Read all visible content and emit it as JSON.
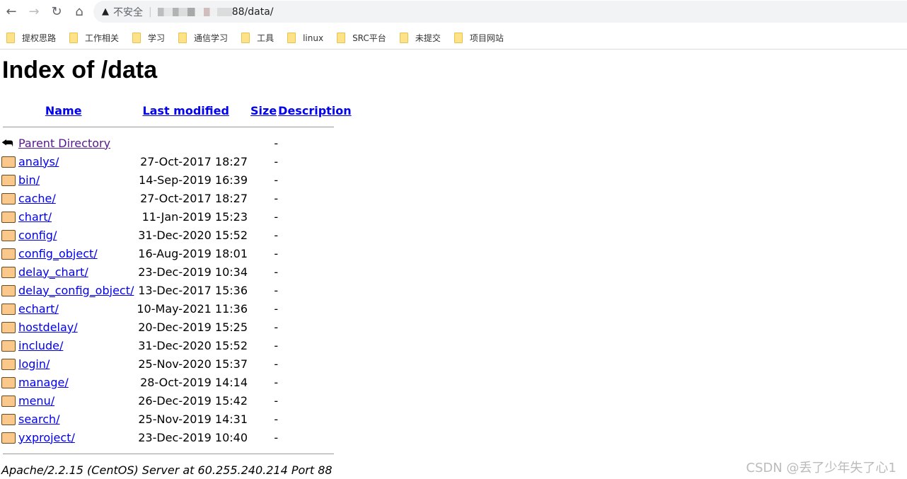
{
  "browser": {
    "url_security": "不安全",
    "url_visible": "88/data/"
  },
  "bookmarks": [
    "提权思路",
    "工作相关",
    "学习",
    "通信学习",
    "工具",
    "linux",
    "SRC平台",
    "未提交",
    "项目网站"
  ],
  "page": {
    "title": "Index of /data",
    "headers": {
      "name": "Name",
      "modified": "Last modified",
      "size": "Size",
      "description": "Description"
    },
    "parent": {
      "name": "Parent Directory",
      "size": "-"
    },
    "rows": [
      {
        "name": "analys/",
        "modified": "27-Oct-2017 18:27",
        "size": "-"
      },
      {
        "name": "bin/",
        "modified": "14-Sep-2019 16:39",
        "size": "-"
      },
      {
        "name": "cache/",
        "modified": "27-Oct-2017 18:27",
        "size": "-"
      },
      {
        "name": "chart/",
        "modified": "11-Jan-2019 15:23",
        "size": "-"
      },
      {
        "name": "config/",
        "modified": "31-Dec-2020 15:52",
        "size": "-"
      },
      {
        "name": "config_object/",
        "modified": "16-Aug-2019 18:01",
        "size": "-"
      },
      {
        "name": "delay_chart/",
        "modified": "23-Dec-2019 10:34",
        "size": "-"
      },
      {
        "name": "delay_config_object/",
        "modified": "13-Dec-2017 15:36",
        "size": "-"
      },
      {
        "name": "echart/",
        "modified": "10-May-2021 11:36",
        "size": "-"
      },
      {
        "name": "hostdelay/",
        "modified": "20-Dec-2019 15:25",
        "size": "-"
      },
      {
        "name": "include/",
        "modified": "31-Dec-2020 15:52",
        "size": "-"
      },
      {
        "name": "login/",
        "modified": "25-Nov-2020 15:37",
        "size": "-"
      },
      {
        "name": "manage/",
        "modified": "28-Oct-2019 14:14",
        "size": "-"
      },
      {
        "name": "menu/",
        "modified": "26-Dec-2019 15:42",
        "size": "-"
      },
      {
        "name": "search/",
        "modified": "25-Nov-2019 14:31",
        "size": "-"
      },
      {
        "name": "yxproject/",
        "modified": "23-Dec-2019 10:40",
        "size": "-"
      }
    ],
    "address": "Apache/2.2.15 (CentOS) Server at 60.255.240.214 Port 88"
  },
  "watermark": "CSDN @丢了少年失了心1"
}
